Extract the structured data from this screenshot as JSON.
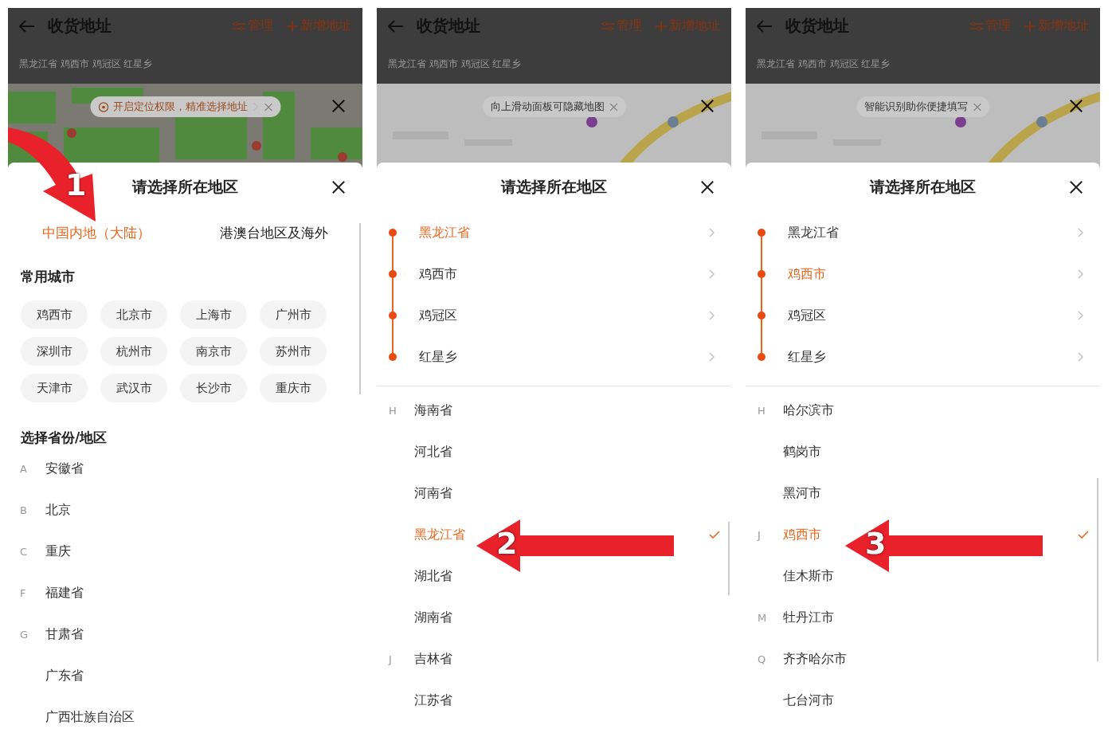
{
  "panels": [
    {
      "header": {
        "title": "收货地址",
        "manage": "管理",
        "add": "新增地址",
        "address": "黑龙江省 鸡西市 鸡冠区 红星乡"
      },
      "tip": {
        "text": "开启定位权限，精准选择地址",
        "location_icon": true,
        "chevron": true
      },
      "sheet_title": "请选择所在地区",
      "tabs": [
        {
          "label": "中国内地（大陆）",
          "selected": true
        },
        {
          "label": "港澳台地区及海外",
          "selected": false
        }
      ],
      "common_cities": {
        "heading": "常用城市",
        "cities": [
          "鸡西市",
          "北京市",
          "上海市",
          "广州市",
          "深圳市",
          "杭州市",
          "南京市",
          "苏州市",
          "天津市",
          "武汉市",
          "长沙市",
          "重庆市"
        ]
      },
      "region_heading": "选择省份/地区",
      "regions": [
        {
          "letter": "A",
          "name": "安徽省",
          "selected": false
        },
        {
          "letter": "B",
          "name": "北京",
          "selected": false
        },
        {
          "letter": "C",
          "name": "重庆",
          "selected": false
        },
        {
          "letter": "F",
          "name": "福建省",
          "selected": false
        },
        {
          "letter": "G",
          "name": "甘肃省",
          "selected": false
        },
        {
          "name": "广东省",
          "selected": false
        },
        {
          "name": "广西壮族自治区",
          "selected": false
        }
      ],
      "annotation": {
        "kind": "curved",
        "label": "1"
      }
    },
    {
      "header": {
        "title": "收货地址",
        "manage": "管理",
        "add": "新增地址",
        "address": "黑龙江省 鸡西市 鸡冠区 红星乡"
      },
      "tip": {
        "text": "向上滑动面板可隐藏地图",
        "location_icon": false,
        "chevron": false
      },
      "sheet_title": "请选择所在地区",
      "steps": [
        {
          "name": "黑龙江省",
          "selected": true
        },
        {
          "name": "鸡西市",
          "selected": false
        },
        {
          "name": "鸡冠区",
          "selected": false
        },
        {
          "name": "红星乡",
          "selected": false
        }
      ],
      "regions": [
        {
          "letter": "H",
          "name": "海南省",
          "selected": false
        },
        {
          "name": "河北省",
          "selected": false
        },
        {
          "name": "河南省",
          "selected": false
        },
        {
          "name": "黑龙江省",
          "selected": true
        },
        {
          "name": "湖北省",
          "selected": false
        },
        {
          "name": "湖南省",
          "selected": false
        },
        {
          "letter": "J",
          "name": "吉林省",
          "selected": false
        },
        {
          "name": "江苏省",
          "selected": false
        }
      ],
      "annotation": {
        "kind": "left",
        "label": "2"
      }
    },
    {
      "header": {
        "title": "收货地址",
        "manage": "管理",
        "add": "新增地址",
        "address": "黑龙江省 鸡西市 鸡冠区 红星乡"
      },
      "tip": {
        "text": "智能识别助你便捷填写",
        "location_icon": false,
        "chevron": false
      },
      "sheet_title": "请选择所在地区",
      "steps": [
        {
          "name": "黑龙江省",
          "selected": false
        },
        {
          "name": "鸡西市",
          "selected": true
        },
        {
          "name": "鸡冠区",
          "selected": false
        },
        {
          "name": "红星乡",
          "selected": false
        }
      ],
      "regions": [
        {
          "letter": "H",
          "name": "哈尔滨市",
          "selected": false
        },
        {
          "name": "鹤岗市",
          "selected": false
        },
        {
          "name": "黑河市",
          "selected": false
        },
        {
          "letter": "J",
          "name": "鸡西市",
          "selected": true
        },
        {
          "name": "佳木斯市",
          "selected": false
        },
        {
          "letter": "M",
          "name": "牡丹江市",
          "selected": false
        },
        {
          "letter": "Q",
          "name": "齐齐哈尔市",
          "selected": false
        },
        {
          "name": "七台河市",
          "selected": false
        }
      ],
      "annotation": {
        "kind": "left",
        "label": "3"
      }
    }
  ]
}
